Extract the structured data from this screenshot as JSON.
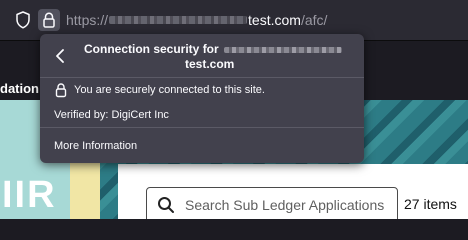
{
  "toolbar": {
    "url_prefix": "https://",
    "url_domain": "test.com",
    "url_path": "/afc/"
  },
  "page": {
    "nav_text": "dation",
    "hero_letter": "IIR",
    "search_placeholder": "Search Sub Ledger Applications",
    "items_count": "27 items"
  },
  "popup": {
    "title_prefix": "Connection security for",
    "title_domain": "test.com",
    "secure_text": "You are securely connected to this site.",
    "verified_text": "Verified by: DigiCert Inc",
    "more_info": "More Information"
  },
  "colors": {
    "toolbar_bg": "#2b2a33",
    "popup_bg": "#42414d",
    "text_light": "#fbfbfe"
  }
}
